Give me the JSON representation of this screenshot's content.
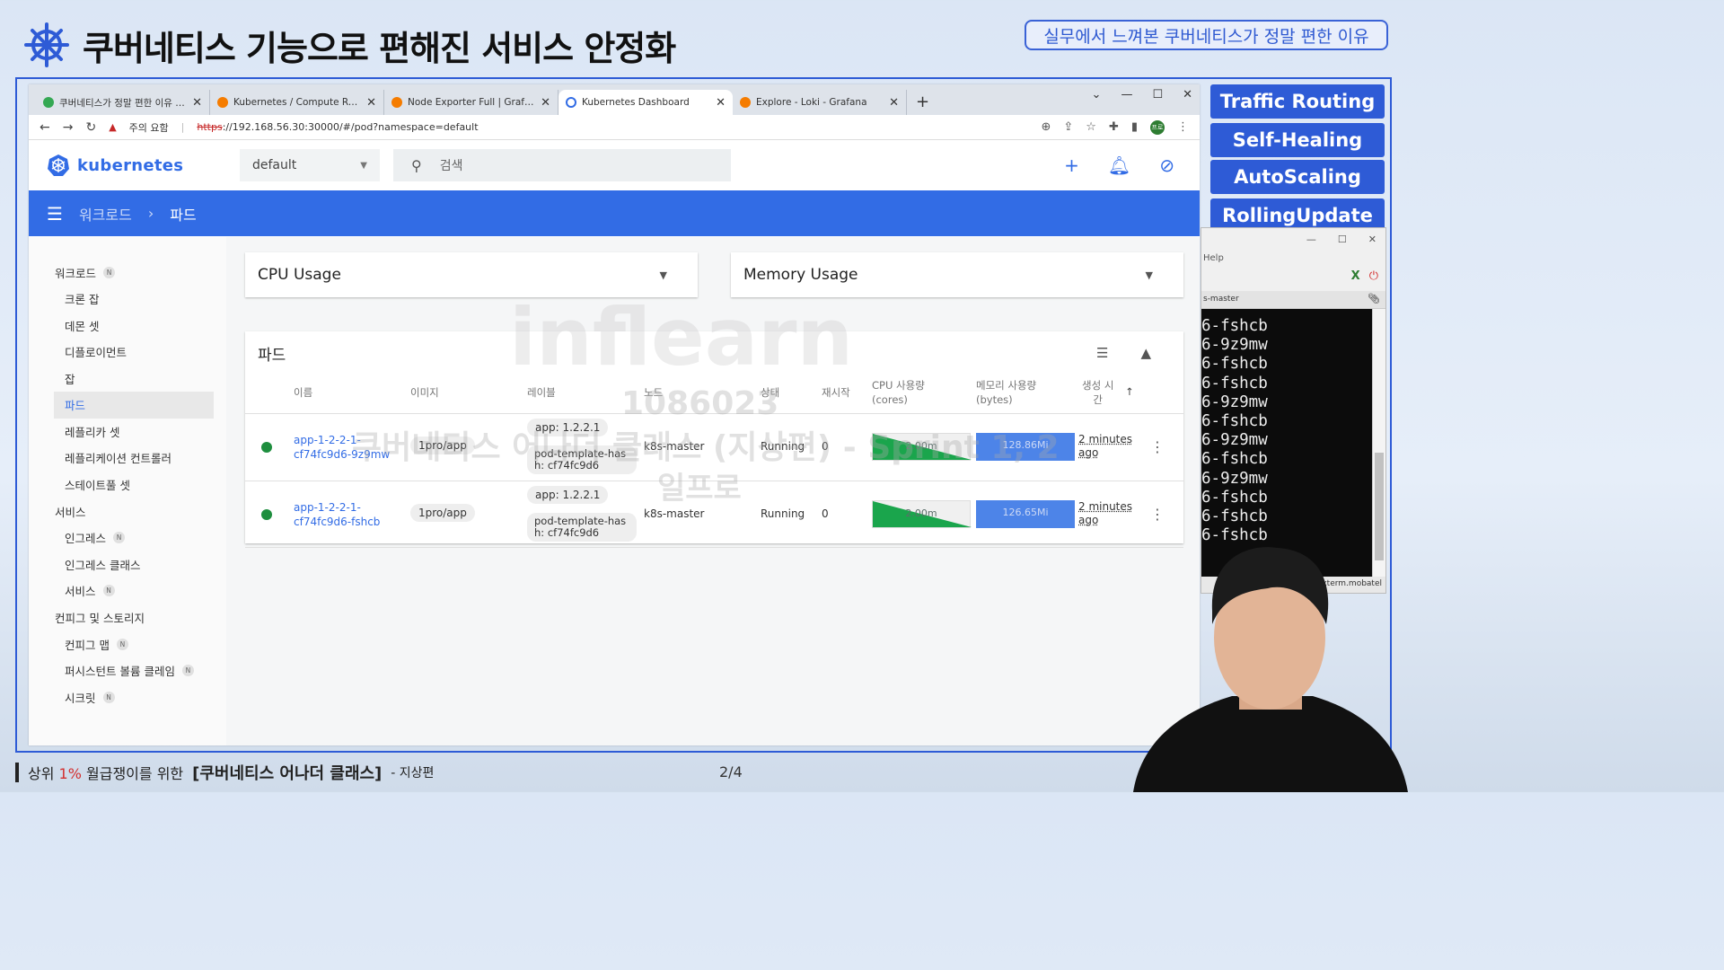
{
  "slide": {
    "title": "쿠버네티스 기능으로 편해진 서비스 안정화",
    "badge": "실무에서 느껴본 쿠버네티스가 정말 편한 이유",
    "features": [
      "Traffic Routing",
      "Self-Healing",
      "AutoScaling",
      "RollingUpdate"
    ],
    "footer": {
      "prefix": "상위 ",
      "highlight": "1%",
      "middle": " 월급쟁이를 위한 ",
      "course": "[쿠버네티스 어나더 클래스]",
      "suffix": "- 지상편"
    },
    "page": "2/4",
    "watermark": {
      "brand": "inflearn",
      "id": "1086023",
      "course": "쿠버네티스 어나더 클래스 (지상편) - Sprint 1, 2",
      "who": "일프로"
    }
  },
  "browser": {
    "tabs": [
      {
        "title": "쿠버네티스가 정말 편한 이유 [지",
        "color": "#34a853"
      },
      {
        "title": "Kubernetes / Compute Resourc",
        "color": "#f57c00"
      },
      {
        "title": "Node Exporter Full | Grafana La",
        "color": "#f57c00"
      },
      {
        "title": "Kubernetes Dashboard",
        "color": "#326ce5"
      },
      {
        "title": "Explore - Loki - Grafana",
        "color": "#f57c00"
      }
    ],
    "warning": "주의 요함",
    "url_scheme": "https",
    "url_rest": "://192.168.56.30:30000/#/pod?namespace=default",
    "profile": "프로"
  },
  "dashboard": {
    "brand": "kubernetes",
    "namespace": "default",
    "search_placeholder": "검색",
    "breadcrumb": [
      "워크로드",
      "파드"
    ],
    "sidebar": {
      "workloads": "워크로드",
      "workload_items": [
        "크론 잡",
        "데몬 셋",
        "디플로이먼트",
        "잡",
        "파드",
        "레플리카 셋",
        "레플리케이션 컨트롤러",
        "스테이트풀 셋"
      ],
      "services": "서비스",
      "ingress": "인그레스",
      "ingress_class": "인그레스 클래스",
      "service": "서비스",
      "config": "컨피그 및 스토리지",
      "configmap": "컨피그 맵",
      "pvc": "퍼시스턴트 볼륨 클레임",
      "secret": "시크릿",
      "badge": "N"
    },
    "cpu_card": "CPU Usage",
    "memory_card": "Memory Usage",
    "pods_title": "파드",
    "columns": {
      "name": "이름",
      "image": "이미지",
      "labels": "레이블",
      "node": "노드",
      "status": "상태",
      "restarts": "재시작",
      "cpu_1": "CPU 사용량",
      "cpu_2": "(cores)",
      "mem_1": "메모리 사용량",
      "mem_2": "(bytes)",
      "age_1": "생성 시",
      "age_2": "간"
    },
    "pods": [
      {
        "name_1": "app-1-2-2-1-",
        "name_2": "cf74fc9d6-9z9mw",
        "image": "1pro/app",
        "label_app": "app: 1.2.2.1",
        "label_hash_1": "pod-template-has",
        "label_hash_2": "h: cf74fc9d6",
        "node": "k8s-master",
        "status": "Running",
        "restarts": "0",
        "cpu": "2.00m",
        "memory": "128.86Mi",
        "age_1": "2 minutes",
        "age_2": "ago"
      },
      {
        "name_1": "app-1-2-2-1-",
        "name_2": "cf74fc9d6-fshcb",
        "image": "1pro/app",
        "label_app": "app: 1.2.2.1",
        "label_hash_1": "pod-template-has",
        "label_hash_2": "h: cf74fc9d6",
        "node": "k8s-master",
        "status": "Running",
        "restarts": "0",
        "cpu": "2.00m",
        "memory": "126.65Mi",
        "age_1": "2 minutes",
        "age_2": "ago"
      }
    ]
  },
  "terminal": {
    "menu_help": "Help",
    "tab": "s-master",
    "status": "mobaxterm.mobatel",
    "lines": [
      "6-fshcb",
      "6-9z9mw",
      "6-fshcb",
      "6-fshcb",
      "6-9z9mw",
      "6-fshcb",
      "6-9z9mw",
      "6-fshcb",
      "6-9z9mw",
      "6-fshcb",
      "6-fshcb",
      "6-fshcb"
    ]
  },
  "colors": {
    "k8s_blue": "#326ce5",
    "slide_blue": "#2e5bd6",
    "running_green": "#1e8e3e"
  }
}
